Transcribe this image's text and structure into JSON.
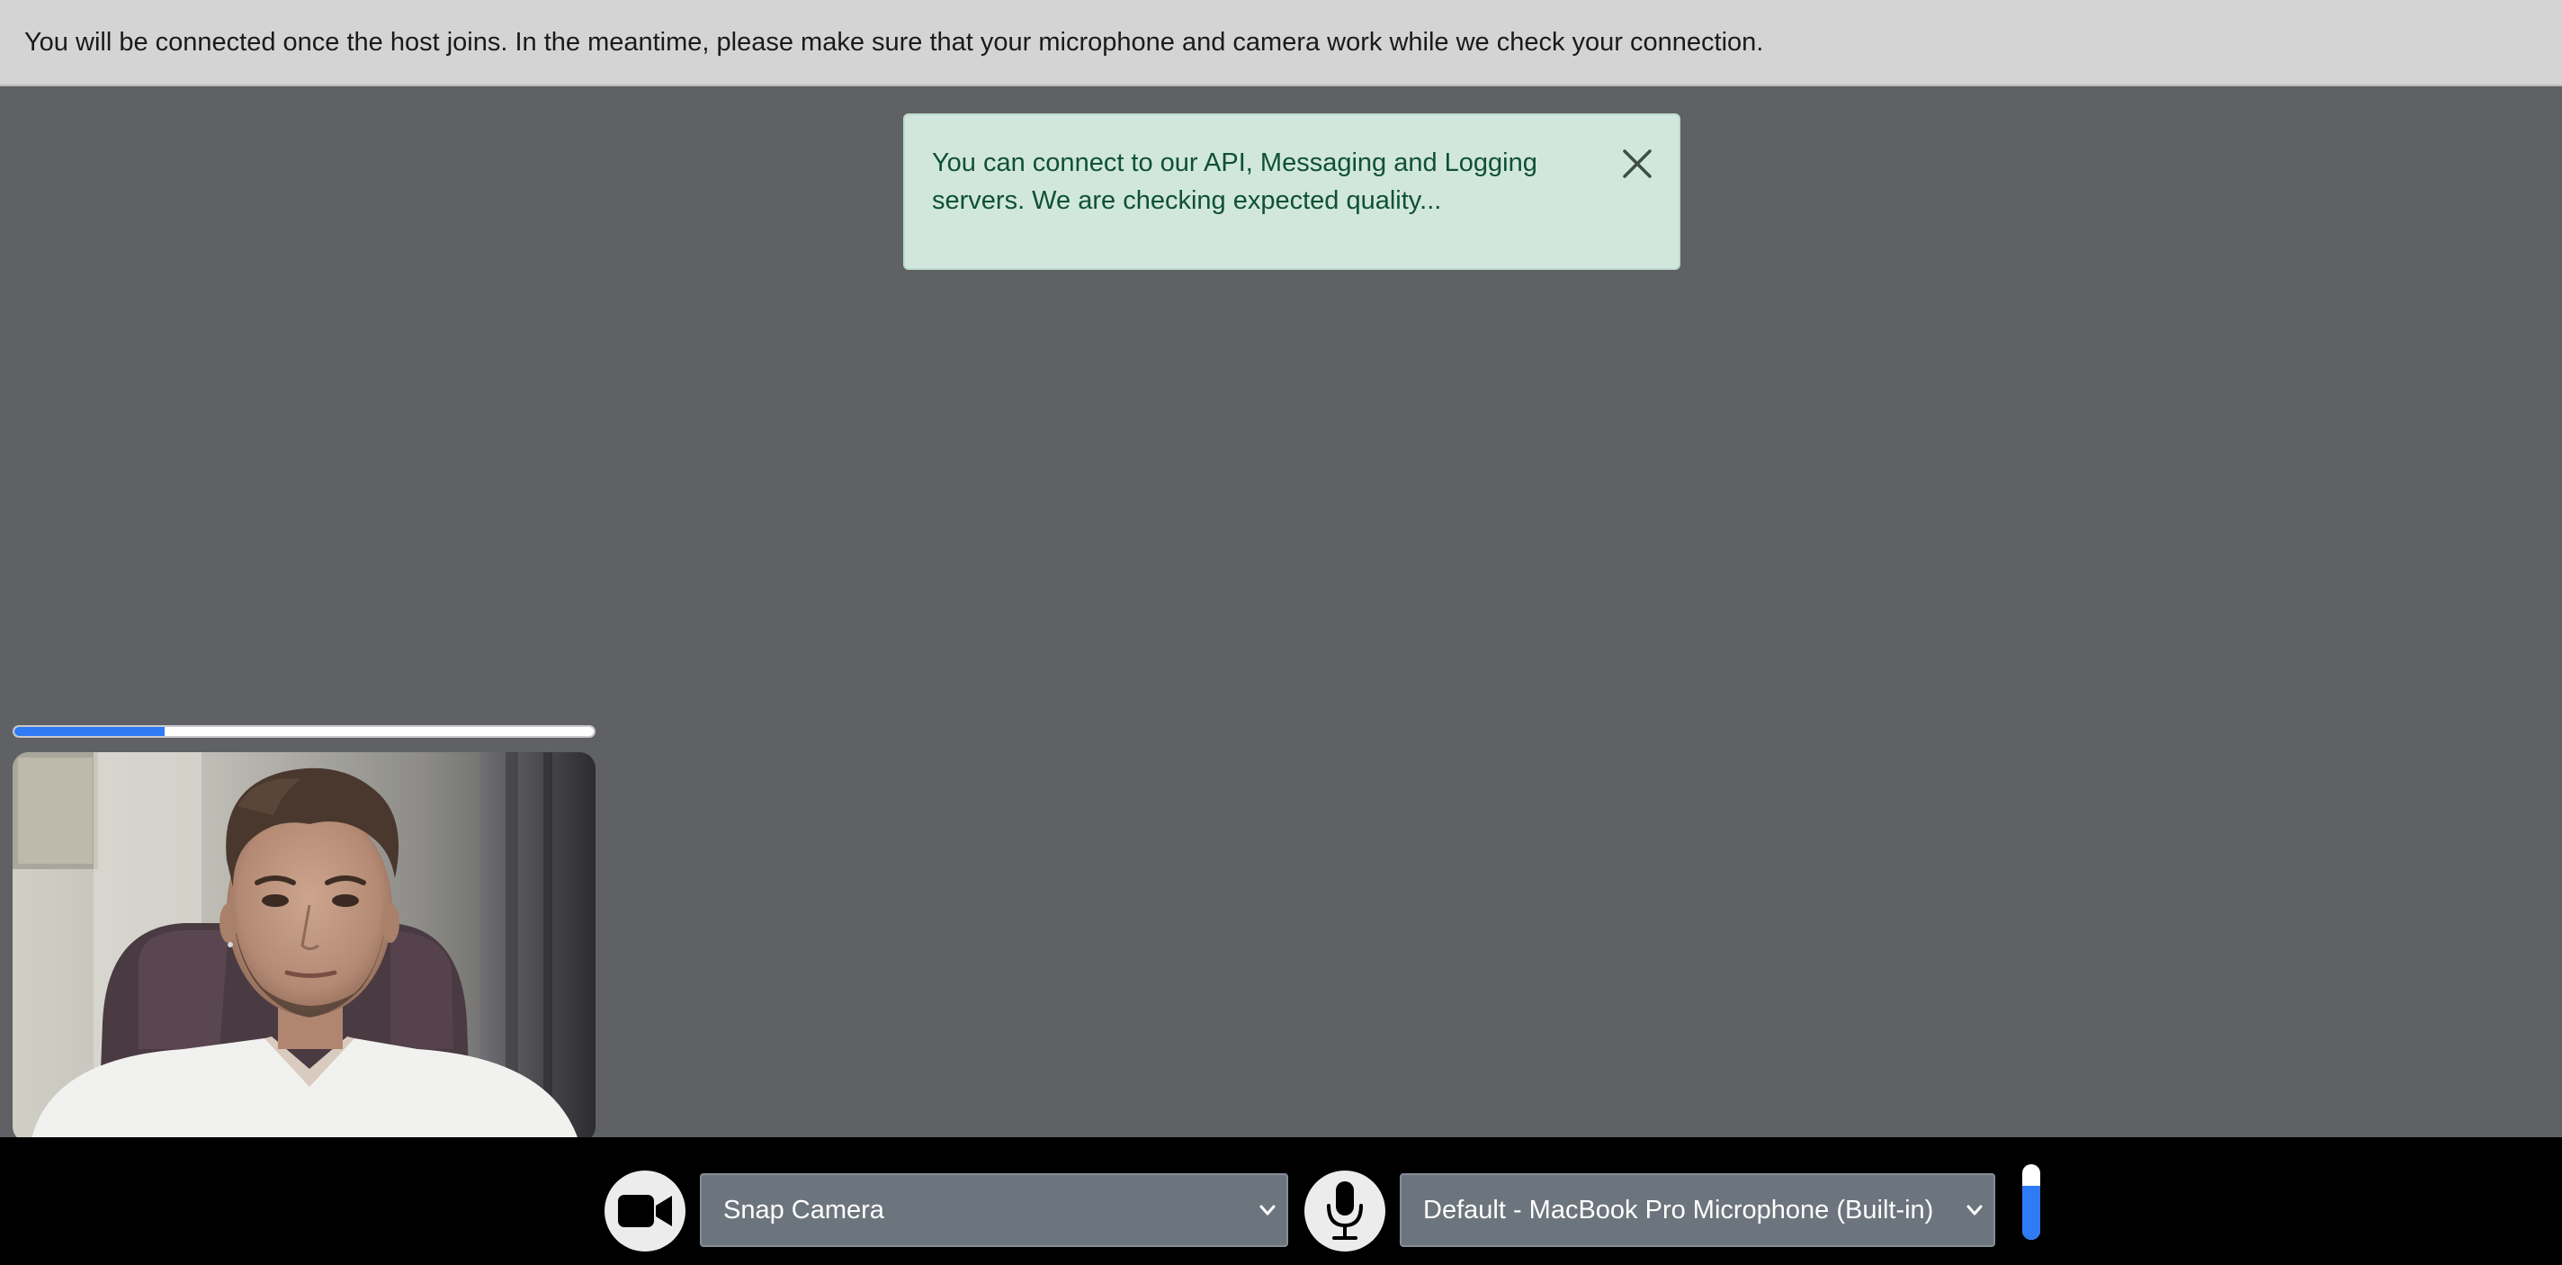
{
  "banner": {
    "message": "You will be connected once the host joins. In the meantime, please make sure that your microphone and camera work while we check your connection."
  },
  "alert": {
    "message": "You can connect to our API, Messaging and Logging servers. We are checking expected quality...",
    "close_icon": "close-icon"
  },
  "connection_check": {
    "progress_fraction": 0.26
  },
  "self_view": {
    "description_icon": "camera-preview"
  },
  "controls": {
    "camera_icon": "video-camera-icon",
    "camera_select": {
      "selected": "Snap Camera"
    },
    "mic_icon": "microphone-icon",
    "mic_select": {
      "selected": "Default - MacBook Pro Microphone (Built-in)"
    },
    "mic_level_fraction": 0.72
  },
  "colors": {
    "accent": "#2f7bf5",
    "alert_bg": "#d1e7dd",
    "alert_text": "#0f5132",
    "select_bg": "#6c757d",
    "page_bg": "#5f6164",
    "banner_bg": "#d4d4d4"
  }
}
